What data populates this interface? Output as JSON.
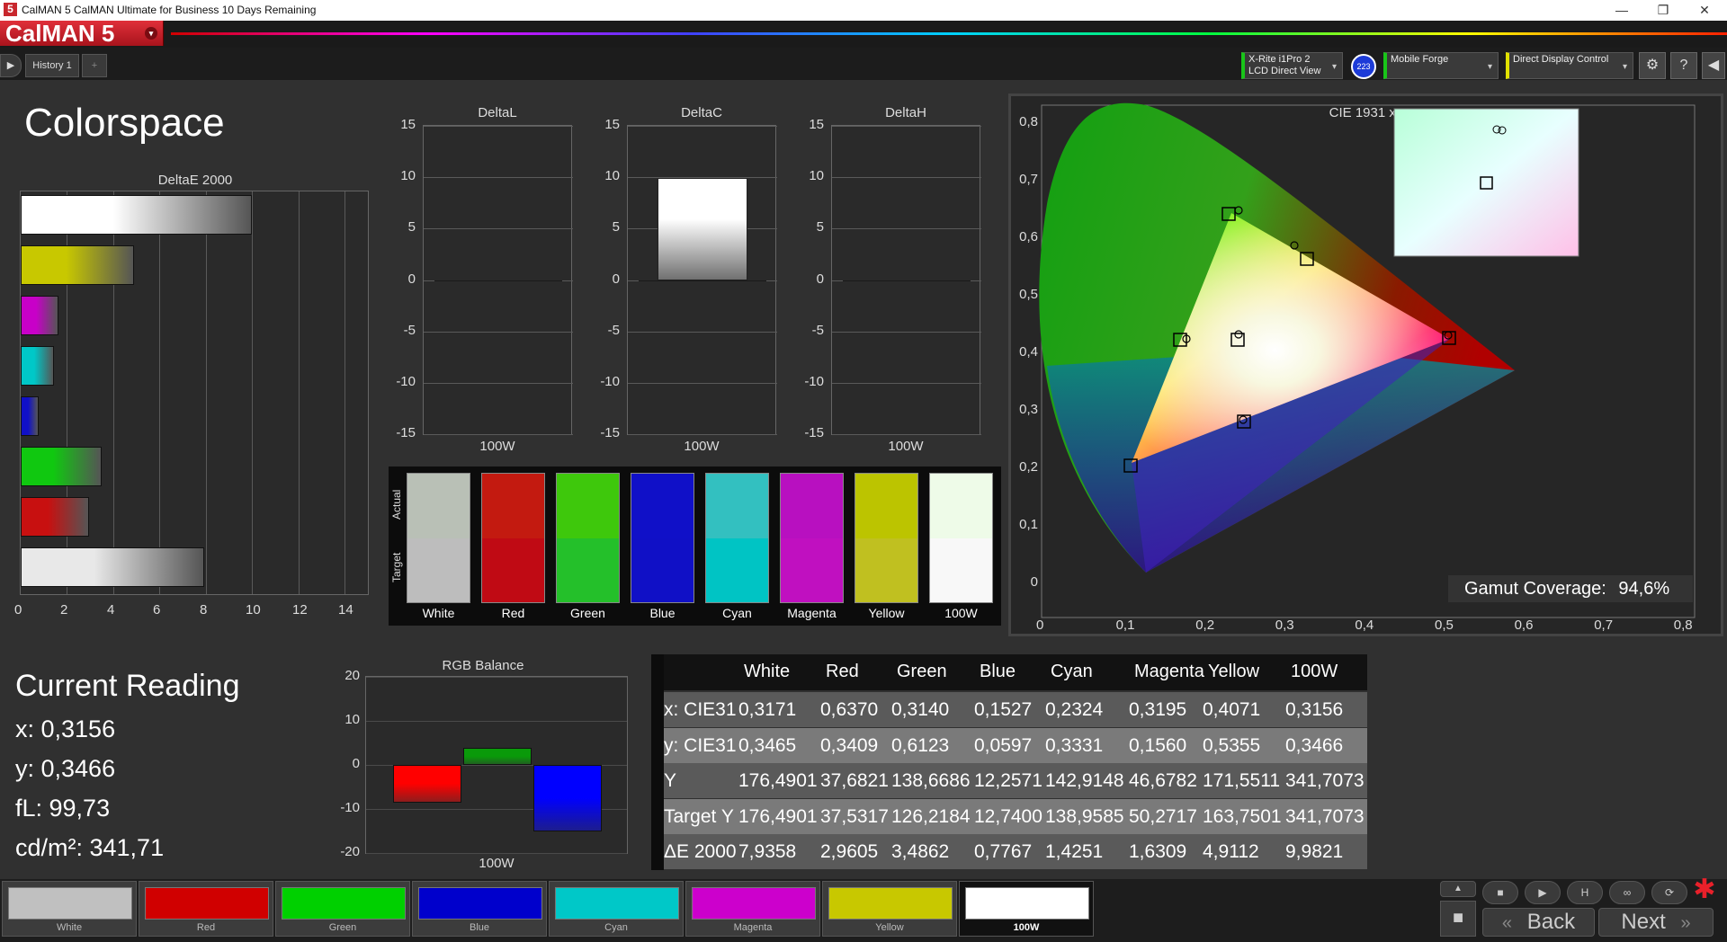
{
  "window": {
    "title": "CalMAN 5 CalMAN Ultimate for Business 10 Days Remaining",
    "logo_char": "5",
    "min": "—",
    "max": "❐",
    "close": "✕"
  },
  "brand": {
    "name": "CalMAN 5",
    "menu_glyph": "▾"
  },
  "tabs": {
    "prev_glyph": "▶",
    "history": "History 1",
    "add_glyph": "+"
  },
  "devices": {
    "meter_line1": "X-Rite i1Pro 2",
    "meter_line2": "LCD Direct View",
    "meter_badge": "223",
    "source": "Mobile Forge",
    "display": "Direct Display Control",
    "arrow": "▾",
    "settings_glyph": "⚙",
    "help_glyph": "?",
    "expand_glyph": "◀"
  },
  "colorspace": {
    "title": "Colorspace"
  },
  "deltae": {
    "title": "DeltaE 2000",
    "ticks": [
      "0",
      "2",
      "4",
      "6",
      "8",
      "10",
      "12",
      "14"
    ],
    "xlim": [
      0,
      15
    ],
    "bars": [
      {
        "name": "100W",
        "value": 9.9821,
        "color": "#ffffff"
      },
      {
        "name": "Yellow",
        "value": 4.9112,
        "color": "#c8c800"
      },
      {
        "name": "Magenta",
        "value": 1.6309,
        "color": "#c800c8"
      },
      {
        "name": "Cyan",
        "value": 1.4251,
        "color": "#00c8c8"
      },
      {
        "name": "Blue",
        "value": 0.7767,
        "color": "#1010c8"
      },
      {
        "name": "Green",
        "value": 3.4862,
        "color": "#10c810"
      },
      {
        "name": "Red",
        "value": 2.9605,
        "color": "#c81010"
      },
      {
        "name": "White",
        "value": 7.9358,
        "color": "#e8e8e8"
      }
    ]
  },
  "delta_charts": [
    {
      "title": "DeltaL",
      "xlabel": "100W",
      "value": 0
    },
    {
      "title": "DeltaC",
      "xlabel": "100W",
      "value": 10
    },
    {
      "title": "DeltaH",
      "xlabel": "100W",
      "value": 0
    }
  ],
  "delta_ticks": [
    "15",
    "10",
    "5",
    "0",
    "-5",
    "-10",
    "-15"
  ],
  "swatches": {
    "actual_label": "Actual",
    "target_label": "Target",
    "items": [
      {
        "name": "White",
        "actual": "#b9c0b6",
        "target": "#bdbdbd"
      },
      {
        "name": "Red",
        "actual": "#c31a10",
        "target": "#c00a14"
      },
      {
        "name": "Green",
        "actual": "#3ec80c",
        "target": "#24c02a"
      },
      {
        "name": "Blue",
        "actual": "#1010c8",
        "target": "#1010c6"
      },
      {
        "name": "Cyan",
        "actual": "#33c0c0",
        "target": "#00c4c4"
      },
      {
        "name": "Magenta",
        "actual": "#b810c0",
        "target": "#c010c0"
      },
      {
        "name": "Yellow",
        "actual": "#bcc400",
        "target": "#c0c020"
      },
      {
        "name": "100W",
        "actual": "#eefbe8",
        "target": "#f8f8f8"
      }
    ]
  },
  "cie": {
    "title": "CIE 1931 xy",
    "xticks": [
      "0",
      "0,1",
      "0,2",
      "0,3",
      "0,4",
      "0,5",
      "0,6",
      "0,7",
      "0,8"
    ],
    "yticks": [
      "0,8",
      "0,7",
      "0,6",
      "0,5",
      "0,4",
      "0,3",
      "0,2",
      "0,1",
      "0"
    ],
    "gamut_label": "Gamut Coverage:",
    "gamut_value": "94,6%"
  },
  "reading": {
    "title": "Current Reading",
    "x": "x: 0,3156",
    "y": "y: 0,3466",
    "fl": "fL: 99,73",
    "cdm2": "cd/m²: 341,71"
  },
  "rgb": {
    "title": "RGB Balance",
    "xlabel": "100W",
    "ticks": [
      "20",
      "10",
      "0",
      "-10",
      "-20"
    ],
    "ylim": [
      -20,
      20
    ],
    "bars": [
      {
        "name": "R",
        "value": -8.5,
        "color": "#ff0000"
      },
      {
        "name": "G",
        "value": 3.8,
        "color": "#0a9a0a"
      },
      {
        "name": "B",
        "value": -15,
        "color": "#0000ff"
      }
    ]
  },
  "table": {
    "headers": [
      "",
      "White",
      "Red",
      "Green",
      "Blue",
      "Cyan",
      "Magenta",
      "Yellow",
      "100W"
    ],
    "rows": [
      [
        "x: CIE31",
        "0,3171",
        "0,6370",
        "0,3140",
        "0,1527",
        "0,2324",
        "0,3195",
        "0,4071",
        "0,3156"
      ],
      [
        "y: CIE31",
        "0,3465",
        "0,3409",
        "0,6123",
        "0,0597",
        "0,3331",
        "0,1560",
        "0,5355",
        "0,3466"
      ],
      [
        "Y",
        "176,4901",
        "37,6821",
        "138,6686",
        "12,2571",
        "142,9148",
        "46,6782",
        "171,5511",
        "341,7073"
      ],
      [
        "Target Y",
        "176,4901",
        "37,5317",
        "126,2184",
        "12,7400",
        "138,9585",
        "50,2717",
        "163,7501",
        "341,7073"
      ],
      [
        "ΔE 2000",
        "7,9358",
        "2,9605",
        "3,4862",
        "0,7767",
        "1,4251",
        "1,6309",
        "4,9112",
        "9,9821"
      ]
    ]
  },
  "bottom": {
    "swatches": [
      {
        "name": "White",
        "color": "#c0c0c0"
      },
      {
        "name": "Red",
        "color": "#d00000"
      },
      {
        "name": "Green",
        "color": "#00d000"
      },
      {
        "name": "Blue",
        "color": "#0000cc"
      },
      {
        "name": "Cyan",
        "color": "#00c8c8"
      },
      {
        "name": "Magenta",
        "color": "#cc00cc"
      },
      {
        "name": "Yellow",
        "color": "#c8c800"
      },
      {
        "name": "100W",
        "color": "#ffffff"
      }
    ],
    "back": "Back",
    "next": "Next",
    "back_glyph": "«",
    "next_glyph": "»",
    "asterisk": "✱"
  }
}
